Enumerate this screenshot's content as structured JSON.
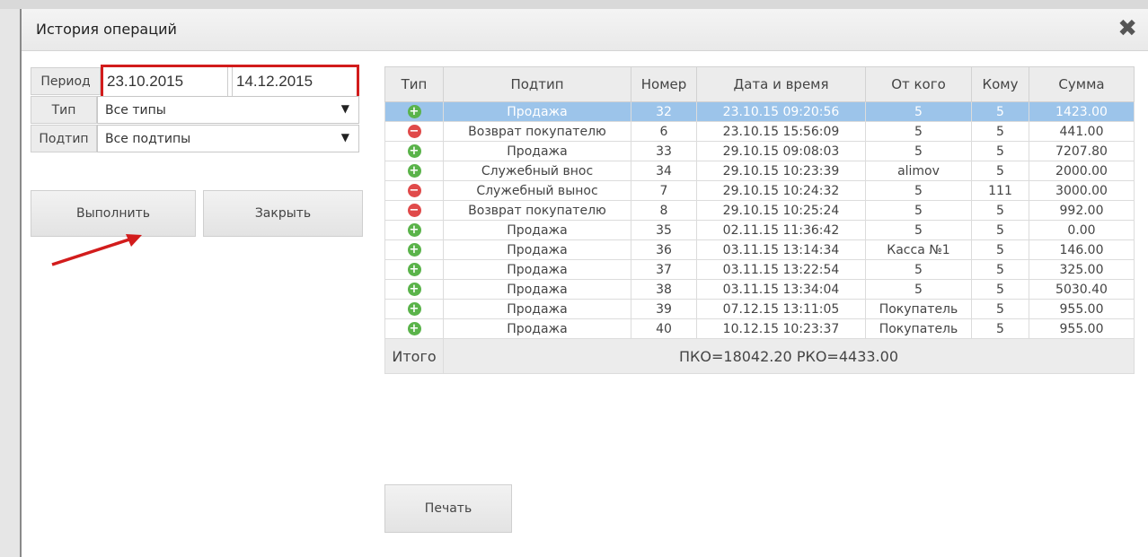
{
  "window": {
    "title": "История операций",
    "close_glyph": "✖"
  },
  "filters": {
    "period_label": "Период",
    "date_from": "23.10.2015",
    "date_to": "14.12.2015",
    "type_label": "Тип",
    "type_value": "Все типы",
    "subtype_label": "Подтип",
    "subtype_value": "Все подтипы",
    "dropdown_glyph": "▼"
  },
  "buttons": {
    "run": "Выполнить",
    "close": "Закрыть",
    "print": "Печать"
  },
  "table": {
    "headers": [
      "Тип",
      "Подтип",
      "Номер",
      "Дата и время",
      "От кого",
      "Кому",
      "Сумма"
    ],
    "rows": [
      {
        "icon": "plus",
        "subtype": "Продажа",
        "num": "32",
        "date": "23.10.15 09:20:56",
        "from": "5",
        "to": "5",
        "sum": "1423.00"
      },
      {
        "icon": "minus",
        "subtype": "Возврат покупателю",
        "num": "6",
        "date": "23.10.15 15:56:09",
        "from": "5",
        "to": "5",
        "sum": "441.00"
      },
      {
        "icon": "plus",
        "subtype": "Продажа",
        "num": "33",
        "date": "29.10.15 09:08:03",
        "from": "5",
        "to": "5",
        "sum": "7207.80"
      },
      {
        "icon": "plus",
        "subtype": "Служебный внос",
        "num": "34",
        "date": "29.10.15 10:23:39",
        "from": "alimov",
        "to": "5",
        "sum": "2000.00"
      },
      {
        "icon": "minus",
        "subtype": "Служебный вынос",
        "num": "7",
        "date": "29.10.15 10:24:32",
        "from": "5",
        "to": "111",
        "sum": "3000.00"
      },
      {
        "icon": "minus",
        "subtype": "Возврат покупателю",
        "num": "8",
        "date": "29.10.15 10:25:24",
        "from": "5",
        "to": "5",
        "sum": "992.00"
      },
      {
        "icon": "plus",
        "subtype": "Продажа",
        "num": "35",
        "date": "02.11.15 11:36:42",
        "from": "5",
        "to": "5",
        "sum": "0.00"
      },
      {
        "icon": "plus",
        "subtype": "Продажа",
        "num": "36",
        "date": "03.11.15 13:14:34",
        "from": "Касса №1",
        "to": "5",
        "sum": "146.00"
      },
      {
        "icon": "plus",
        "subtype": "Продажа",
        "num": "37",
        "date": "03.11.15 13:22:54",
        "from": "5",
        "to": "5",
        "sum": "325.00"
      },
      {
        "icon": "plus",
        "subtype": "Продажа",
        "num": "38",
        "date": "03.11.15 13:34:04",
        "from": "5",
        "to": "5",
        "sum": "5030.40"
      },
      {
        "icon": "plus",
        "subtype": "Продажа",
        "num": "39",
        "date": "07.12.15 13:11:05",
        "from": "Покупатель",
        "to": "5",
        "sum": "955.00"
      },
      {
        "icon": "plus",
        "subtype": "Продажа",
        "num": "40",
        "date": "10.12.15 10:23:37",
        "from": "Покупатель",
        "to": "5",
        "sum": "955.00"
      }
    ],
    "selected_row": 0,
    "total_label": "Итого",
    "total_value": "ПКО=18042.20 РКО=4433.00"
  },
  "colors": {
    "accent_highlight": "#d21c1c",
    "selected_row": "#9cc4ea",
    "plus_icon": "#5ab34a",
    "minus_icon": "#e04a4a",
    "arrow": "#d21c1c"
  }
}
